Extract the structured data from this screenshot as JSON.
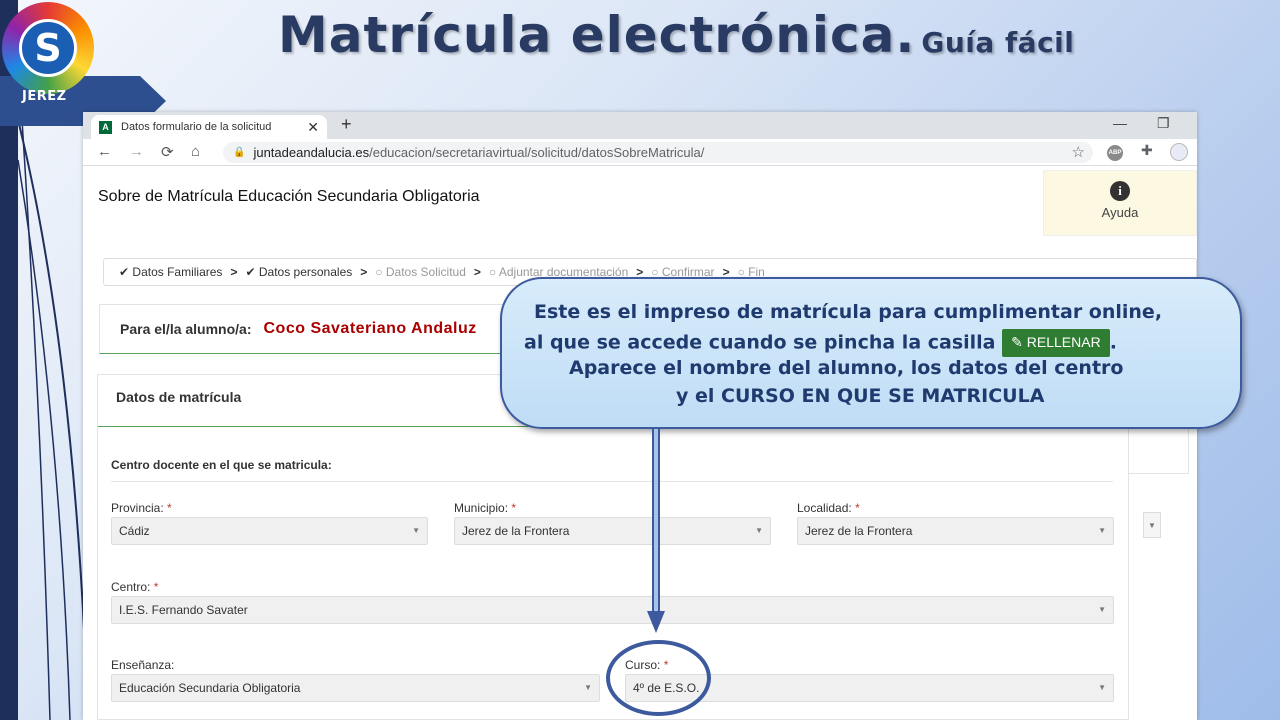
{
  "slide": {
    "title": "Matrícula electrónica.",
    "subtitle": "Guía fácil",
    "logo_letter": "S",
    "logo_city": "JEREZ"
  },
  "browser": {
    "tab_title": "Datos formulario de la solicitud",
    "favicon_letter": "A",
    "tab_close": "✕",
    "new_tab": "+",
    "url_domain": "juntadeandalucia.es",
    "url_path": "/educacion/secretariavirtual/solicitud/datosSobreMatricula/",
    "window_minimize": "—",
    "window_restore": "❐",
    "ext_abp": "ABP",
    "nav": {
      "back": "←",
      "forward": "→",
      "reload": "⟳",
      "home": "⌂",
      "star": "☆",
      "puzzle": "✚"
    }
  },
  "page": {
    "heading": "Sobre de Matrícula Educación Secundaria Obligatoria",
    "help_icon": "i",
    "help_label": "Ayuda",
    "steps": [
      {
        "label": "Datos Familiares",
        "state": "done",
        "icon": "✔"
      },
      {
        "label": "Datos personales",
        "state": "done",
        "icon": "✔"
      },
      {
        "label": "Datos Solicitud",
        "state": "pending",
        "icon": "○"
      },
      {
        "label": "Adjuntar documentación",
        "state": "pending",
        "icon": "○"
      },
      {
        "label": "Confirmar",
        "state": "pending",
        "icon": "○"
      },
      {
        "label": "Fin",
        "state": "pending",
        "icon": "○"
      }
    ],
    "step_separator": ">",
    "student_label": "Para el/la alumno/a:",
    "student_name": "Coco Savateriano Andaluz",
    "panel_title": "Datos de matrícula",
    "section_title": "Centro docente en el que se matricula:",
    "required_mark": "*",
    "fields": {
      "provincia": {
        "label": "Provincia:",
        "value": "Cádiz"
      },
      "municipio": {
        "label": "Municipio:",
        "value": "Jerez de la Frontera"
      },
      "localidad": {
        "label": "Localidad:",
        "value": "Jerez de la Frontera"
      },
      "centro": {
        "label": "Centro:",
        "value": "I.E.S. Fernando Savater"
      },
      "ensenanza": {
        "label": "Enseñanza:",
        "value": "Educación Secundaria Obligatoria"
      },
      "curso": {
        "label": "Curso:",
        "value": "4º de E.S.O."
      }
    },
    "caret": "▼"
  },
  "callout": {
    "line1": "Este es el impreso de matrícula para cumplimentar online,",
    "line2": "al que se accede cuando se pincha la casilla",
    "button_label": "✎ RELLENAR",
    "line2_end": ".",
    "line3": "Aparece el nombre del alumno, los datos del centro",
    "line4": "y el CURSO EN QUE SE MATRICULA"
  },
  "colors": {
    "title": "#2a3b63",
    "callout_border": "#3d5a9e",
    "rellenar_bg": "#2e7d32",
    "student_name": "#aa0000",
    "accent_line": "#5aa05a"
  }
}
